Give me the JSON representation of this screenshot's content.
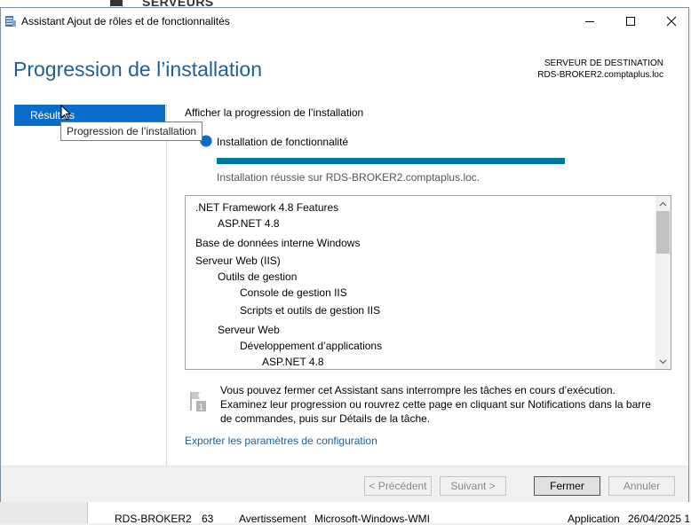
{
  "background": {
    "header_text": "SERVEURS",
    "row": {
      "server": "RDS-BROKER2",
      "id": "63",
      "severity": "Avertissement",
      "source": "Microsoft-Windows-WMI",
      "log": "Application",
      "date": "26/04/2025 1"
    }
  },
  "window": {
    "title": "Assistant Ajout de rôles et de fonctionnalités",
    "icons": {
      "app": "server-manager-icon",
      "minimize": "minimize-icon",
      "maximize": "maximize-icon",
      "close": "close-icon"
    }
  },
  "page": {
    "title": "Progression de l’installation",
    "destination_label": "SERVEUR DE DESTINATION",
    "destination_server": "RDS-BROKER2.comptaplus.loc"
  },
  "nav": {
    "items": [
      {
        "label": "Résultats",
        "selected": true
      }
    ],
    "tooltip": "Progression de l’installation"
  },
  "main": {
    "heading": "Afficher la progression de l’installation",
    "feature_label": "Installation de fonctionnalité",
    "progress": 1.0,
    "result": "Installation réussie sur RDS-BROKER2.comptaplus.loc.",
    "features": [
      {
        "text": ".NET Framework 4.8 Features",
        "level": 0
      },
      {
        "text": "ASP.NET 4.8",
        "level": 1
      },
      {
        "text": "Base de données interne Windows",
        "level": 0
      },
      {
        "text": "Serveur Web (IIS)",
        "level": 0
      },
      {
        "text": "Outils de gestion",
        "level": 1
      },
      {
        "text": "Console de gestion IIS",
        "level": 2
      },
      {
        "text": "Scripts et outils de gestion IIS",
        "level": 2
      },
      {
        "text": "Serveur Web",
        "level": 1
      },
      {
        "text": "Développement d’applications",
        "level": 2
      },
      {
        "text": "ASP.NET 4.8",
        "level": 3
      }
    ],
    "note": "Vous pouvez fermer cet Assistant sans interrompre les tâches en cours d’exécution. Examinez leur progression ou rouvrez cette page en cliquant sur Notifications dans la barre de commandes, puis sur Détails de la tâche.",
    "export_link": "Exporter les paramètres de configuration"
  },
  "footer": {
    "previous": "< Précédent",
    "next": "Suivant >",
    "close": "Fermer",
    "cancel": "Annuler"
  },
  "colors": {
    "title": "#1e5f9a",
    "nav_selected": "#0a6cc9",
    "progress": "#0077a7",
    "link": "#1a5fa0"
  }
}
